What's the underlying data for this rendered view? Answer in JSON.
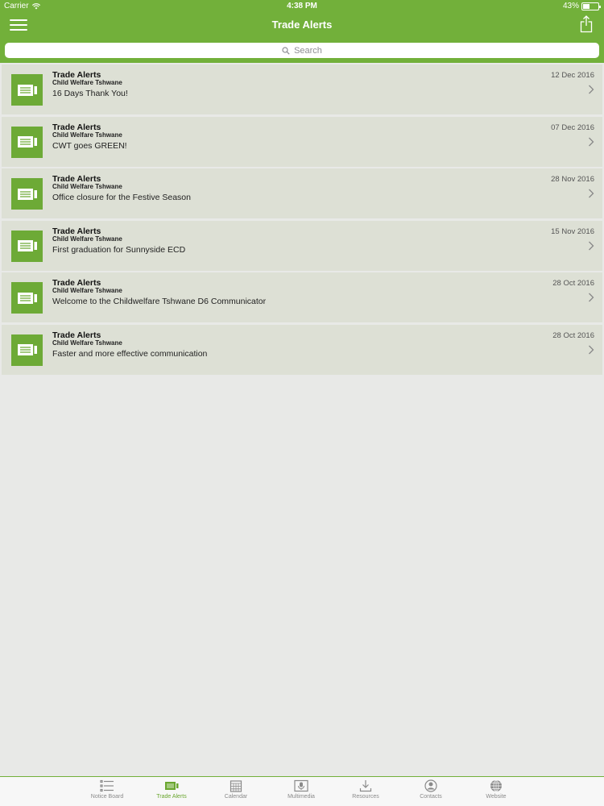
{
  "status_bar": {
    "carrier": "Carrier",
    "time": "4:38 PM",
    "battery": "43%"
  },
  "nav": {
    "title": "Trade Alerts"
  },
  "search": {
    "placeholder": "Search"
  },
  "colors": {
    "brand_green": "#72b03a",
    "row_bg": "#dde0d5",
    "active_tab": "#6aa62f"
  },
  "alerts": [
    {
      "heading": "Trade Alerts",
      "org": "Child Welfare Tshwane",
      "subject": "16 Days Thank You!",
      "date": "12 Dec 2016"
    },
    {
      "heading": "Trade Alerts",
      "org": "Child Welfare Tshwane",
      "subject": "CWT goes GREEN!",
      "date": "07 Dec 2016"
    },
    {
      "heading": "Trade Alerts",
      "org": "Child Welfare Tshwane",
      "subject": "Office closure for the Festive Season",
      "date": "28 Nov 2016"
    },
    {
      "heading": "Trade Alerts",
      "org": "Child Welfare Tshwane",
      "subject": "First graduation for Sunnyside ECD",
      "date": "15 Nov 2016"
    },
    {
      "heading": "Trade Alerts",
      "org": "Child Welfare Tshwane",
      "subject": "Welcome to the Childwelfare Tshwane D6 Communicator",
      "date": "28 Oct 2016"
    },
    {
      "heading": "Trade Alerts",
      "org": "Child Welfare Tshwane",
      "subject": "Faster and more effective communication",
      "date": "28 Oct 2016"
    }
  ],
  "tabs": [
    {
      "label": "Notice Board",
      "icon": "list-icon"
    },
    {
      "label": "Trade Alerts",
      "icon": "ticket-icon",
      "active": true
    },
    {
      "label": "Calendar",
      "icon": "calendar-icon"
    },
    {
      "label": "Multimedia",
      "icon": "microphone-icon"
    },
    {
      "label": "Resources",
      "icon": "download-icon"
    },
    {
      "label": "Contacts",
      "icon": "contact-icon"
    },
    {
      "label": "Website",
      "icon": "globe-icon"
    }
  ]
}
